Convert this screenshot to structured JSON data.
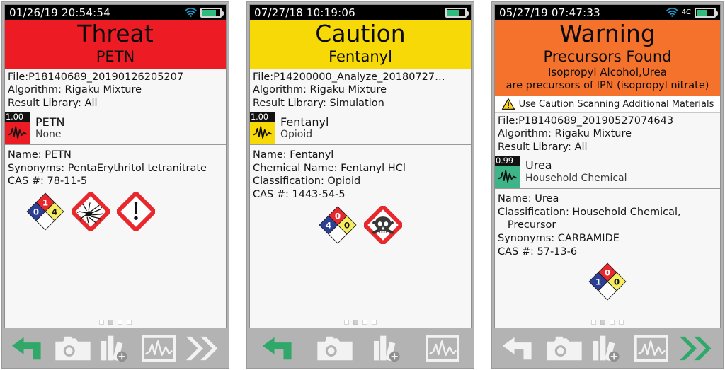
{
  "panels": [
    {
      "id": "threat-petn",
      "statusbar": {
        "clock": "01/26/19  20:54:54",
        "wifi": "wifi-icon",
        "net_label": "",
        "battery_pct": 78
      },
      "banner": {
        "bg": "#ed1c24",
        "verdict": "Threat",
        "subject": "PETN",
        "sub2": "",
        "sub3": ""
      },
      "caution_strip": {
        "visible": false,
        "text": ""
      },
      "meta": [
        "File:P18140689_20190126205207",
        "Algorithm: Rigaku Mixture",
        "Result Library: All"
      ],
      "result": {
        "score": "1.00",
        "swatch_color": "#ed1c24",
        "name": "PETN",
        "classification": "None"
      },
      "details": [
        "Name: PETN",
        "Synonyms: PentaErythritol tetranitrate",
        "CAS #: 78-11-5"
      ],
      "nfpa": {
        "visible": true,
        "health": "0",
        "fire": "1",
        "reactivity": "4",
        "special": ""
      },
      "ghs": [
        "exploding-bomb-icon",
        "exclamation-mark-icon"
      ],
      "picto_align": "left-pad",
      "dots": {
        "count": 4,
        "active": 1
      },
      "toolbar": [
        {
          "icon": "back-arrow-icon",
          "color": "#2fa86a"
        },
        {
          "icon": "camera-icon",
          "color": "#f2f2f2"
        },
        {
          "icon": "library-add-icon",
          "color": "#f2f2f2"
        },
        {
          "icon": "spectrum-icon",
          "color": "#f2f2f2"
        },
        {
          "icon": "double-chevron-right-icon",
          "color": "#f2f2f2"
        }
      ]
    },
    {
      "id": "caution-fentanyl",
      "statusbar": {
        "clock": "07/27/18  10:19:06",
        "wifi": "",
        "net_label": "",
        "battery_pct": 72
      },
      "banner": {
        "bg": "#f7d908",
        "verdict": "Caution",
        "subject": "Fentanyl",
        "sub2": "",
        "sub3": ""
      },
      "caution_strip": {
        "visible": false,
        "text": ""
      },
      "meta": [
        "File:P14200000_Analyze_20180727…",
        "Algorithm: Rigaku Mixture",
        "Result Library: Simulation"
      ],
      "result": {
        "score": "1.00",
        "swatch_color": "#f7d908",
        "name": "Fentanyl",
        "classification": "Opioid"
      },
      "details": [
        "Name: Fentanyl",
        "Chemical Name: Fentanyl HCl",
        "Classification: Opioid",
        "CAS #: 1443-54-5"
      ],
      "nfpa": {
        "visible": true,
        "health": "4",
        "fire": "0",
        "reactivity": "0",
        "special": ""
      },
      "ghs": [
        "skull-crossbones-icon"
      ],
      "picto_align": "center",
      "dots": {
        "count": 4,
        "active": 1
      },
      "toolbar": [
        {
          "icon": "back-arrow-icon",
          "color": "#2fa86a"
        },
        {
          "icon": "camera-icon",
          "color": "#f2f2f2"
        },
        {
          "icon": "library-add-icon",
          "color": "#f2f2f2"
        },
        {
          "icon": "spectrum-icon",
          "color": "#f2f2f2"
        }
      ]
    },
    {
      "id": "warning-precursors",
      "statusbar": {
        "clock": "05/27/19  07:47:33",
        "wifi": "wifi-icon",
        "net_label": "4C",
        "battery_pct": 62
      },
      "banner": {
        "bg": "#f4722b",
        "verdict": "Warning",
        "subject": "Precursors Found",
        "sub2": "Isopropyl Alcohol,Urea",
        "sub3": "are precursors of IPN  (isopropyl nitrate)"
      },
      "caution_strip": {
        "visible": true,
        "text": "Use Caution Scanning Additional Materials"
      },
      "meta": [
        "File:P18140689_20190527074643",
        "Algorithm: Rigaku Mixture",
        "Result Library: All"
      ],
      "result": {
        "score": "0.99",
        "swatch_color": "#3eb489",
        "name": "Urea",
        "classification": "Household Chemical"
      },
      "details": [
        "Name: Urea",
        "Classification: Household Chemical,",
        "   Precursor",
        "Synonyms: CARBAMIDE",
        "CAS #: 57-13-6"
      ],
      "nfpa": {
        "visible": true,
        "health": "1",
        "fire": "0",
        "reactivity": "0",
        "special": ""
      },
      "ghs": [],
      "picto_align": "center",
      "dots": {
        "count": 4,
        "active": 1
      },
      "toolbar": [
        {
          "icon": "back-arrow-icon",
          "color": "#f2f2f2"
        },
        {
          "icon": "camera-icon",
          "color": "#f2f2f2"
        },
        {
          "icon": "library-add-icon",
          "color": "#f2f2f2"
        },
        {
          "icon": "spectrum-icon",
          "color": "#f2f2f2"
        },
        {
          "icon": "double-chevron-right-icon",
          "color": "#2fa86a"
        }
      ]
    }
  ],
  "colors": {
    "threat_red": "#ed1c24",
    "caution_yellow": "#f7d908",
    "warning_orange": "#f4722b",
    "safe_green": "#3eb489",
    "accent_green": "#2fa86a",
    "bezel_gray": "#b3b3b3"
  }
}
